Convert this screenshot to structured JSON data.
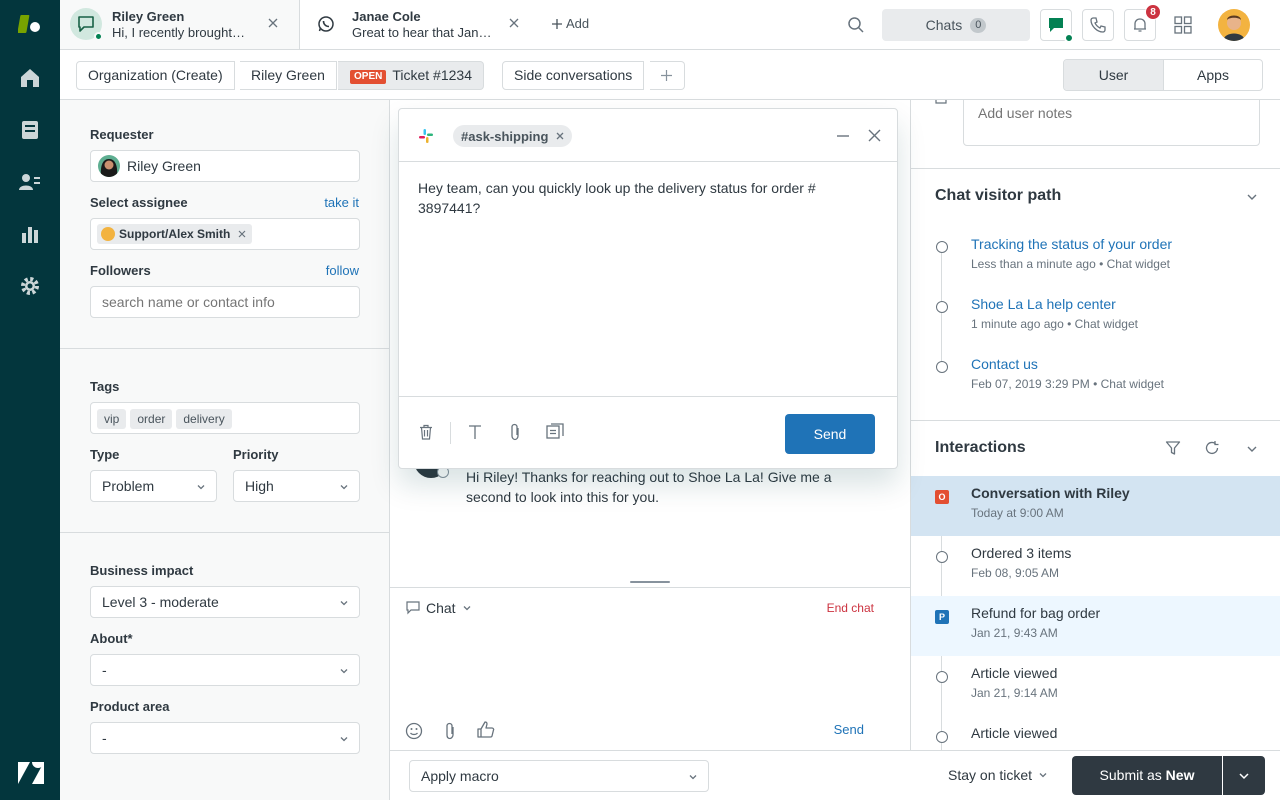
{
  "nav": {
    "icons": [
      "zendesk-logo-icon",
      "home-icon",
      "views-icon",
      "customers-icon",
      "reporting-icon",
      "admin-gear-icon",
      "zendesk-z-icon"
    ]
  },
  "topbar": {
    "tabs": [
      {
        "name": "Riley Green",
        "preview": "Hi, I recently brought…"
      },
      {
        "name": "Janae Cole",
        "preview": "Great to hear that Jan…"
      }
    ],
    "add_label": "Add",
    "chats_label": "Chats",
    "chats_count": "0",
    "notifications_count": "8"
  },
  "subbar": {
    "crumbs": [
      "Organization (Create)",
      "Riley Green"
    ],
    "ticket_status": "OPEN",
    "ticket_label": "Ticket #1234",
    "side_conversations": "Side conversations",
    "toggle": [
      "User",
      "Apps"
    ]
  },
  "left": {
    "requester_label": "Requester",
    "requester_value": "Riley Green",
    "assignee_label": "Select assignee",
    "take_it": "take it",
    "assignee_value": "Support/Alex Smith",
    "followers_label": "Followers",
    "follow": "follow",
    "followers_placeholder": "search name or contact info",
    "tags_label": "Tags",
    "tags": [
      "vip",
      "order",
      "delivery"
    ],
    "type_label": "Type",
    "type_value": "Problem",
    "priority_label": "Priority",
    "priority_value": "High",
    "impact_label": "Business impact",
    "impact_value": "Level 3 - moderate",
    "about_label": "About*",
    "about_value": "-",
    "product_label": "Product area",
    "product_value": "-"
  },
  "center": {
    "message": "Hi Riley! Thanks for reaching out to Shoe La La! Give me a second to look into this for you.",
    "channel": "Chat",
    "end_chat": "End chat",
    "send": "Send"
  },
  "modal": {
    "channel_tag": "#ask-shipping",
    "body": "Hey team, can you quickly look up the delivery status for order # 3897441?",
    "send": "Send"
  },
  "right": {
    "notes_placeholder": "Add user notes",
    "path_title": "Chat visitor path",
    "path": [
      {
        "title": "Tracking the status of your order",
        "sub": "Less than a minute ago • Chat widget"
      },
      {
        "title": "Shoe La La help center",
        "sub": "1 minute ago ago • Chat widget"
      },
      {
        "title": "Contact us",
        "sub": "Feb 07, 2019 3:29 PM • Chat widget"
      }
    ],
    "interactions_title": "Interactions",
    "interactions": [
      {
        "title": "Conversation with Riley",
        "sub": "Today at 9:00 AM",
        "badge": "O",
        "badge_color": "#e34f32",
        "selected": true
      },
      {
        "title": "Ordered 3 items",
        "sub": "Feb 08, 9:05 AM"
      },
      {
        "title": "Refund for bag order",
        "sub": "Jan 21, 9:43 AM",
        "badge": "P",
        "badge_color": "#1f73b7"
      },
      {
        "title": "Article viewed",
        "sub": "Jan 21, 9:14 AM"
      },
      {
        "title": "Article viewed",
        "sub": ""
      }
    ]
  },
  "bottom": {
    "macro_placeholder": "Apply macro",
    "stay": "Stay on ticket",
    "submit_prefix": "Submit as",
    "submit_status": "New"
  },
  "colors": {
    "nav": "#03363d",
    "link": "#1f73b7",
    "primary": "#1f73b7",
    "submit": "#2f3941",
    "danger": "#cc3340",
    "open_badge": "#e34f32",
    "selected_row": "#d3e4f2"
  }
}
